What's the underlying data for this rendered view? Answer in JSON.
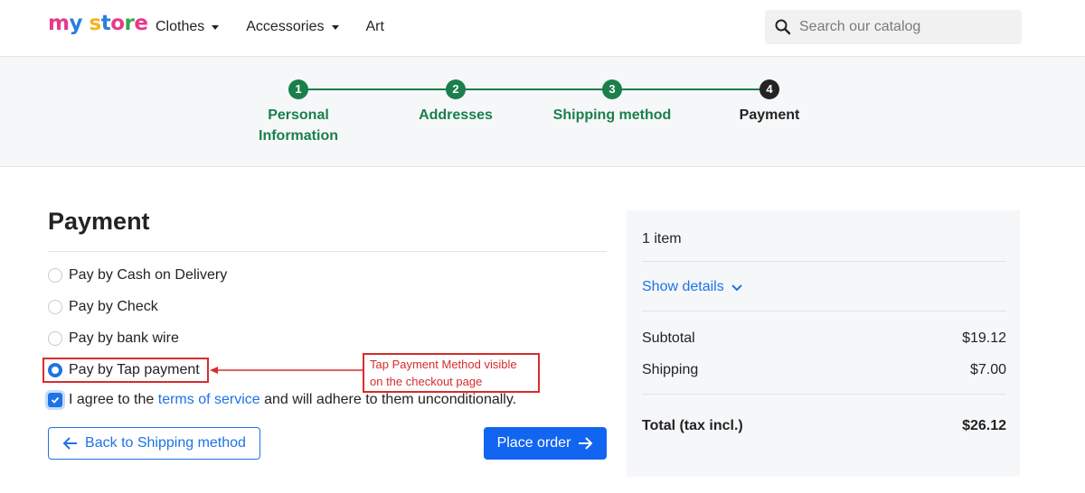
{
  "header": {
    "logo_text": "my store",
    "nav": [
      {
        "label": "Clothes",
        "has_dropdown": true
      },
      {
        "label": "Accessories",
        "has_dropdown": true
      },
      {
        "label": "Art",
        "has_dropdown": false
      }
    ],
    "search": {
      "placeholder": "Search our catalog",
      "icon": "search-icon"
    }
  },
  "steps": [
    {
      "number": "1",
      "label": "Personal Information",
      "status": "done"
    },
    {
      "number": "2",
      "label": "Addresses",
      "status": "done"
    },
    {
      "number": "3",
      "label": "Shipping method",
      "status": "done"
    },
    {
      "number": "4",
      "label": "Payment",
      "status": "current"
    }
  ],
  "payment": {
    "title": "Payment",
    "options": [
      {
        "label": "Pay by Cash on Delivery",
        "selected": false
      },
      {
        "label": "Pay by Check",
        "selected": false
      },
      {
        "label": "Pay by bank wire",
        "selected": false
      },
      {
        "label": "Pay by Tap payment",
        "selected": true
      }
    ],
    "agree": {
      "prefix": "I agree to the",
      "link": "terms of service",
      "suffix": "and will adhere to them unconditionally.",
      "checked": true
    },
    "back_button": "Back to Shipping method",
    "place_order_button": "Place order"
  },
  "annotation": {
    "line1": "Tap Payment Method visible",
    "line2": "on the checkout page"
  },
  "summary": {
    "items_count": "1 item",
    "show_details": "Show details",
    "subtotal_label": "Subtotal",
    "subtotal_value": "$19.12",
    "shipping_label": "Shipping",
    "shipping_value": "$7.00",
    "total_label": "Total (tax incl.)",
    "total_value": "$26.12"
  },
  "colors": {
    "step_done": "#1a7f4b",
    "step_current": "#232323",
    "accent": "#1e73e6",
    "annotation": "#d62c2c"
  }
}
